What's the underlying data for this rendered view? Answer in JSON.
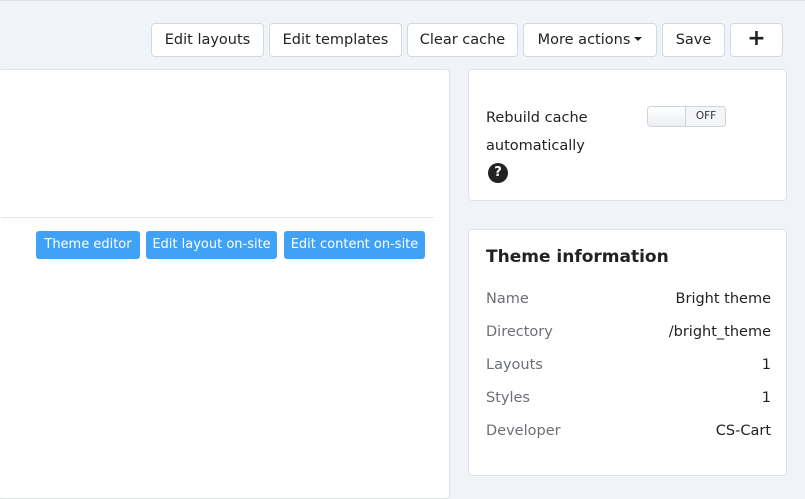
{
  "toolbar": {
    "edit_layouts": "Edit layouts",
    "edit_templates": "Edit templates",
    "clear_cache": "Clear cache",
    "more_actions": "More actions",
    "save": "Save",
    "add": "+"
  },
  "theme_actions": {
    "theme_editor": "Theme editor",
    "edit_layout_on_site": "Edit layout on-site",
    "edit_content_on_site": "Edit content on-site"
  },
  "cache": {
    "rebuild_label_line1": "Rebuild cache",
    "rebuild_label_line2": "automatically",
    "help": "?",
    "toggle_state": "OFF"
  },
  "theme_info": {
    "title": "Theme information",
    "rows": [
      {
        "key": "Name",
        "value": "Bright theme"
      },
      {
        "key": "Directory",
        "value": "/bright_theme"
      },
      {
        "key": "Layouts",
        "value": "1"
      },
      {
        "key": "Styles",
        "value": "1"
      },
      {
        "key": "Developer",
        "value": "CS-Cart"
      }
    ]
  },
  "colors": {
    "accent_blue": "#3fa2f7",
    "page_background": "#f0f3f7"
  }
}
